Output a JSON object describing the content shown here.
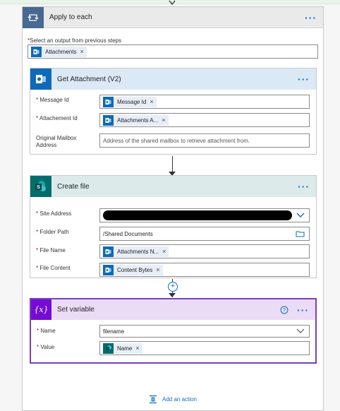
{
  "apply_each": {
    "title": "Apply to each",
    "select_label": "Select an output from previous steps",
    "select_token": "Attachments"
  },
  "get_attachment": {
    "title": "Get Attachment (V2)",
    "message_id_label": "Message Id",
    "message_id_token": "Message Id",
    "attachment_id_label": "Attachement Id",
    "attachment_id_token": "Attachments A...",
    "mailbox_label_line1": "Original Mailbox",
    "mailbox_label_line2": "Address",
    "mailbox_placeholder": "Address of the shared mailbox to retrieve attachment from."
  },
  "create_file": {
    "title": "Create file",
    "site_label": "Site Address",
    "folder_label": "Folder Path",
    "folder_value": "/Shared Documents",
    "name_label": "File Name",
    "name_token": "Attachments N...",
    "content_label": "File Content",
    "content_token": "Content Bytes"
  },
  "set_variable": {
    "title": "Set variable",
    "name_label": "Name",
    "name_value": "filename",
    "value_label": "Value",
    "value_token": "Name"
  },
  "add_action": "Add an action",
  "icons": {
    "loop": "loop-icon",
    "outlook": "outlook-icon",
    "sharepoint": "sharepoint-icon",
    "variable": "variable-icon",
    "help": "help-icon"
  },
  "colors": {
    "loop": "#486991",
    "outlook": "#0e6ab8",
    "sharepoint": "#056c6c",
    "variable": "#770bd6",
    "link": "#0f6cbd"
  }
}
